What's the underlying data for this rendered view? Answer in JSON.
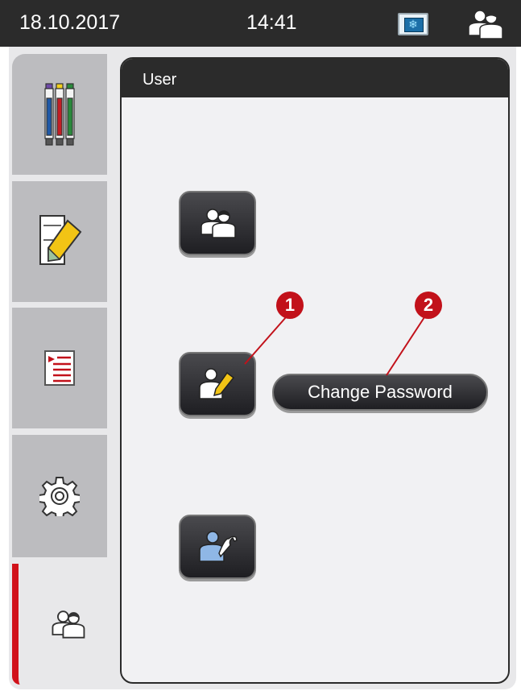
{
  "status_bar": {
    "date": "18.10.2017",
    "time": "14:41",
    "status_icon": "snowflake-display-icon",
    "user_icon": "user-group-icon"
  },
  "sidebar": {
    "items": [
      {
        "name": "reagents-tab",
        "icon": "reagent-vials-icon"
      },
      {
        "name": "programs-tab",
        "icon": "edit-document-icon"
      },
      {
        "name": "protocols-tab",
        "icon": "list-document-icon"
      },
      {
        "name": "settings-tab",
        "icon": "gear-icon"
      },
      {
        "name": "user-tab",
        "icon": "user-group-icon",
        "active": true
      }
    ]
  },
  "panel": {
    "title": "User",
    "buttons": [
      {
        "name": "standard-user-button",
        "icon": "user-group-icon"
      },
      {
        "name": "supervisor-button",
        "icon": "user-edit-icon"
      },
      {
        "name": "service-button",
        "icon": "user-wrench-icon"
      }
    ],
    "change_password_label": "Change Password"
  },
  "callouts": [
    "1",
    "2"
  ],
  "colors": {
    "accent_red": "#c2111a",
    "header_dark": "#2b2b2b",
    "sidebar_gray": "#bcbcbf"
  }
}
